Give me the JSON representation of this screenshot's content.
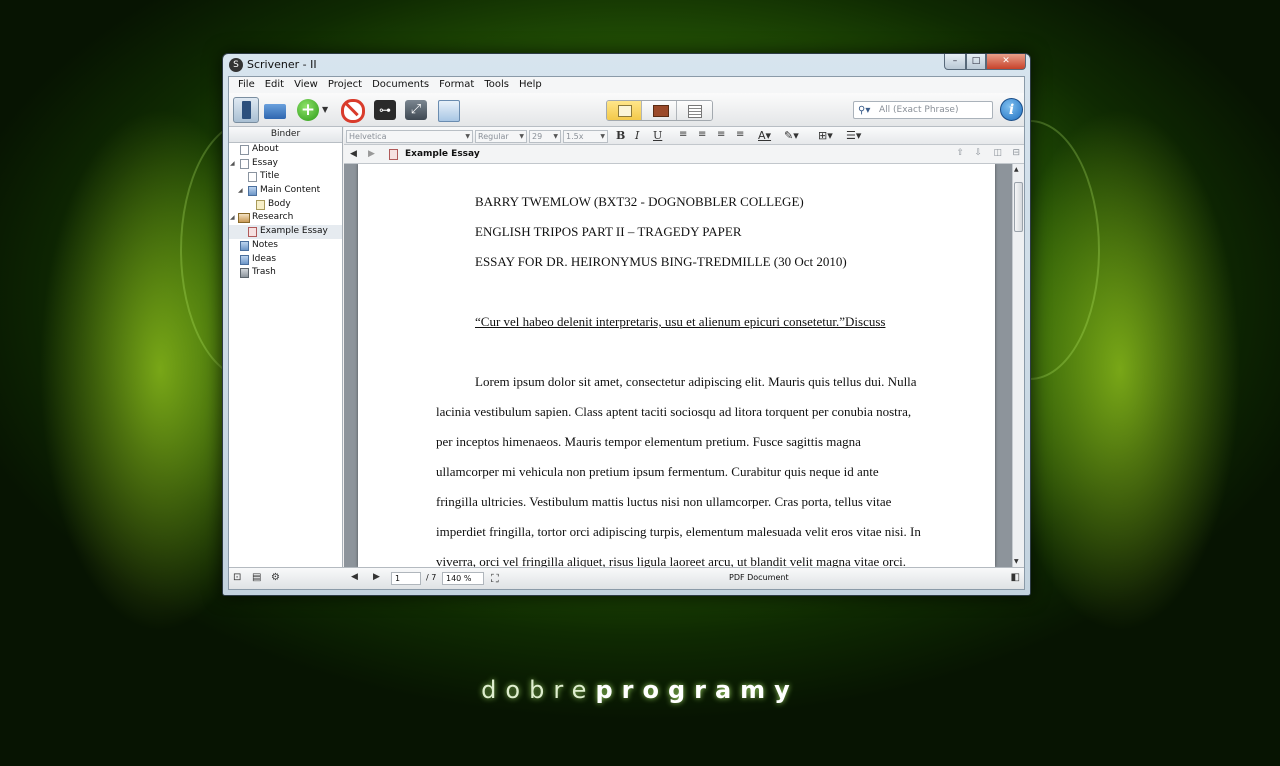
{
  "window": {
    "title": "Scrivener - II"
  },
  "menu": [
    "File",
    "Edit",
    "View",
    "Project",
    "Documents",
    "Format",
    "Tools",
    "Help"
  ],
  "search": {
    "placeholder": "All (Exact Phrase)"
  },
  "binder": {
    "header": "Binder",
    "items": [
      {
        "label": "About"
      },
      {
        "label": "Essay"
      },
      {
        "label": "Title"
      },
      {
        "label": "Main Content"
      },
      {
        "label": "Body"
      },
      {
        "label": "Research"
      },
      {
        "label": "Example Essay"
      },
      {
        "label": "Notes"
      },
      {
        "label": "Ideas"
      },
      {
        "label": "Trash"
      }
    ]
  },
  "format": {
    "font": "Helvetica",
    "style": "Regular",
    "size": "29",
    "spacing": "1.5x"
  },
  "editor": {
    "doc_title": "Example Essay",
    "lines": [
      "BARRY TWEMLOW (BXT32 - DOGNOBBLER COLLEGE)",
      "ENGLISH TRIPOS PART II – TRAGEDY PAPER",
      "ESSAY FOR DR. HEIRONYMUS BING-TREDMILLE (30 Oct 2010)",
      "“Cur vel habeo delenit interpretaris, usu et alienum epicuri consetetur.”Discuss",
      "Lorem ipsum dolor sit amet, consectetur adipiscing elit. Mauris quis tellus dui. Nulla",
      "lacinia vestibulum sapien. Class aptent taciti sociosqu ad litora torquent per conubia nostra,",
      "per inceptos himenaeos. Mauris tempor elementum pretium. Fusce sagittis magna",
      "ullamcorper mi vehicula non pretium ipsum fermentum. Curabitur quis neque id ante",
      "fringilla ultricies. Vestibulum mattis luctus nisi non ullamcorper. Cras porta, tellus vitae",
      "imperdiet fringilla, tortor orci adipiscing turpis, elementum malesuada velit eros vitae nisi. In",
      "viverra, orci vel fringilla aliquet, risus ligula laoreet arcu, ut blandit velit magna vitae orci."
    ]
  },
  "footer": {
    "page": "1",
    "page_total": "/ 7",
    "zoom": "140 %",
    "doc_type": "PDF Document"
  },
  "brand": {
    "light": "dobre",
    "bold": "programy"
  }
}
